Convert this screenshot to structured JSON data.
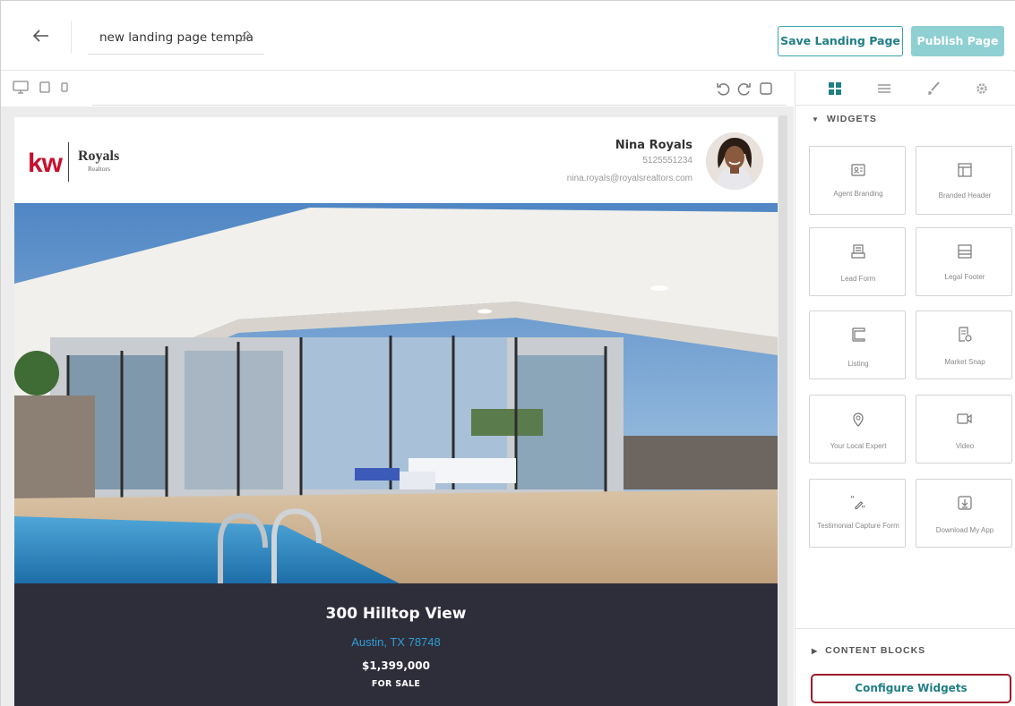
{
  "topbar": {
    "page_name": "new landing page templa",
    "save_label": "Save Landing Page",
    "publish_label": "Publish Page"
  },
  "agent": {
    "brand": "kw",
    "office_name": "Royals",
    "office_sub": "Realtors",
    "name": "Nina Royals",
    "phone": "5125551234",
    "email": "nina.royals@royalsrealtors.com"
  },
  "listing": {
    "address": "300 Hilltop View",
    "city": "Austin, TX 78748",
    "price": "$1,399,000",
    "status": "FOR SALE"
  },
  "panel": {
    "widgets_heading": "WIDGETS",
    "widgets": [
      {
        "label": "Agent Branding",
        "icon": "agent-card-icon"
      },
      {
        "label": "Branded Header",
        "icon": "header-layout-icon"
      },
      {
        "label": "Lead Form",
        "icon": "form-tray-icon"
      },
      {
        "label": "Legal Footer",
        "icon": "footer-layout-icon"
      },
      {
        "label": "Listing",
        "icon": "listing-frame-icon"
      },
      {
        "label": "Market Snap",
        "icon": "document-pin-icon"
      },
      {
        "label": "Your Local Expert",
        "icon": "location-pin-icon"
      },
      {
        "label": "Video",
        "icon": "video-camera-icon"
      },
      {
        "label": "Testimonial Capture Form",
        "icon": "quote-pen-icon"
      },
      {
        "label": "Download My App",
        "icon": "download-box-icon"
      }
    ],
    "content_blocks_heading": "CONTENT BLOCKS",
    "configure_label": "Configure Widgets"
  },
  "colors": {
    "accent_teal": "#36a5ac",
    "publish_bg": "#8fd0d3",
    "info_bg": "#2e2d3a",
    "city_blue": "#2f9fd3",
    "kw_red": "#c8102e",
    "highlight_border": "#9e1b2c"
  }
}
